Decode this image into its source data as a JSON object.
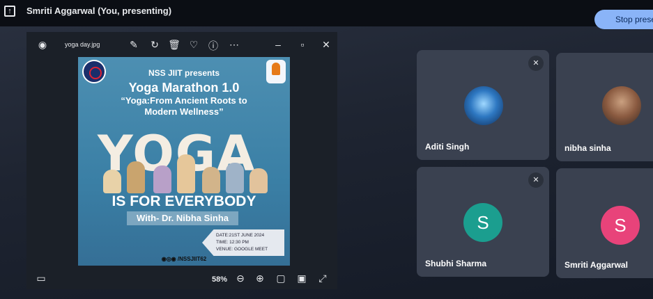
{
  "header": {
    "presenting_text": "Smriti Aggarwal (You, presenting)",
    "stop_button": "Stop preser"
  },
  "viewer": {
    "file_name": "yoga day.jpg",
    "zoom_level": "58%"
  },
  "poster": {
    "presenter": "NSS JIIT presents",
    "event": "Yoga Marathon 1.0",
    "tagline_1": "“Yoga:From Ancient Roots to",
    "tagline_2": "Modern Wellness”",
    "big_word": "YOGA",
    "slogan": "IS FOR EVERYBODY",
    "with_line": "With- Dr. Nibha Sinha",
    "date_line": "DATE:21ST JUNE 2024",
    "time_line": "TIME: 12:30 PM",
    "venue_line": "VENUE: GOOGLE MEET",
    "handle": "/NSSJIIT62"
  },
  "participants": [
    {
      "name": "Aditi Singh",
      "muted": true
    },
    {
      "name": "nibha sinha",
      "muted": false
    },
    {
      "name": "Shubhi Sharma",
      "muted": true,
      "initial": "S",
      "color": "#1b9e8f"
    },
    {
      "name": "Smriti Aggarwal",
      "muted": false,
      "initial": "S",
      "color": "#e8437a"
    }
  ],
  "colors": {
    "accent": "#8ab4f8",
    "tile": "#3a4150"
  }
}
